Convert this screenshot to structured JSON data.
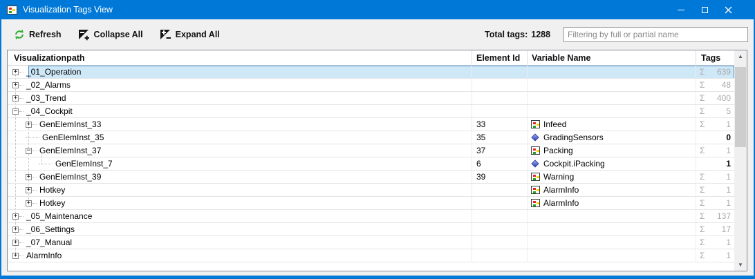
{
  "window": {
    "title": "Visualization Tags View"
  },
  "toolbar": {
    "refresh_label": "Refresh",
    "collapse_label": "Collapse All",
    "expand_label": "Expand All",
    "total_tags_label": "Total tags:",
    "total_tags_value": "1288",
    "filter_placeholder": "Filtering by full or partial name"
  },
  "table": {
    "columns": [
      "Visualizationpath",
      "Element Id",
      "Variable Name",
      "Tags"
    ],
    "sigma_symbol": "Σ",
    "rows": [
      {
        "path": "_01_Operation",
        "level": 0,
        "expander": "plus",
        "element_id": "",
        "var_icon": "",
        "var_name": "",
        "tags": "639",
        "sum": true,
        "selected": true
      },
      {
        "path": "_02_Alarms",
        "level": 0,
        "expander": "plus",
        "element_id": "",
        "var_icon": "",
        "var_name": "",
        "tags": "48",
        "sum": true,
        "selected": false
      },
      {
        "path": "_03_Trend",
        "level": 0,
        "expander": "plus",
        "element_id": "",
        "var_icon": "",
        "var_name": "",
        "tags": "400",
        "sum": true,
        "selected": false
      },
      {
        "path": "_04_Cockpit",
        "level": 0,
        "expander": "minus",
        "element_id": "",
        "var_icon": "",
        "var_name": "",
        "tags": "5",
        "sum": true,
        "selected": false
      },
      {
        "path": "GenElemInst_33",
        "level": 1,
        "expander": "plus",
        "element_id": "33",
        "var_icon": "visu",
        "var_name": "Infeed",
        "tags": "1",
        "sum": true,
        "selected": false
      },
      {
        "path": "GenElemInst_35",
        "level": 1,
        "expander": "none",
        "element_id": "35",
        "var_icon": "tag",
        "var_name": "GradingSensors",
        "tags": "0",
        "sum": false,
        "selected": false
      },
      {
        "path": "GenElemInst_37",
        "level": 1,
        "expander": "minus",
        "element_id": "37",
        "var_icon": "visu",
        "var_name": "Packing",
        "tags": "1",
        "sum": true,
        "selected": false
      },
      {
        "path": "GenElemInst_7",
        "level": 2,
        "expander": "none",
        "element_id": "6",
        "var_icon": "tag",
        "var_name": "Cockpit.iPacking",
        "tags": "1",
        "sum": false,
        "selected": false
      },
      {
        "path": "GenElemInst_39",
        "level": 1,
        "expander": "plus",
        "element_id": "39",
        "var_icon": "visu",
        "var_name": "Warning",
        "tags": "1",
        "sum": true,
        "selected": false
      },
      {
        "path": "Hotkey",
        "level": 1,
        "expander": "plus",
        "element_id": "",
        "var_icon": "visu",
        "var_name": "AlarmInfo",
        "tags": "1",
        "sum": true,
        "selected": false
      },
      {
        "path": "Hotkey",
        "level": 1,
        "expander": "plus",
        "element_id": "",
        "var_icon": "visu",
        "var_name": "AlarmInfo",
        "tags": "1",
        "sum": true,
        "selected": false
      },
      {
        "path": "_05_Maintenance",
        "level": 0,
        "expander": "plus",
        "element_id": "",
        "var_icon": "",
        "var_name": "",
        "tags": "137",
        "sum": true,
        "selected": false
      },
      {
        "path": "_06_Settings",
        "level": 0,
        "expander": "plus",
        "element_id": "",
        "var_icon": "",
        "var_name": "",
        "tags": "17",
        "sum": true,
        "selected": false
      },
      {
        "path": "_07_Manual",
        "level": 0,
        "expander": "plus",
        "element_id": "",
        "var_icon": "",
        "var_name": "",
        "tags": "1",
        "sum": true,
        "selected": false
      },
      {
        "path": "AlarmInfo",
        "level": 0,
        "expander": "plus",
        "element_id": "",
        "var_icon": "",
        "var_name": "",
        "tags": "1",
        "sum": true,
        "selected": false
      }
    ]
  },
  "colors": {
    "accent_blue": "#0078d7",
    "selection_fill": "#cfe8f8",
    "selection_border": "#4a90c8",
    "sum_gray": "#a8a8a8",
    "refresh_green": "#2fae2f"
  }
}
